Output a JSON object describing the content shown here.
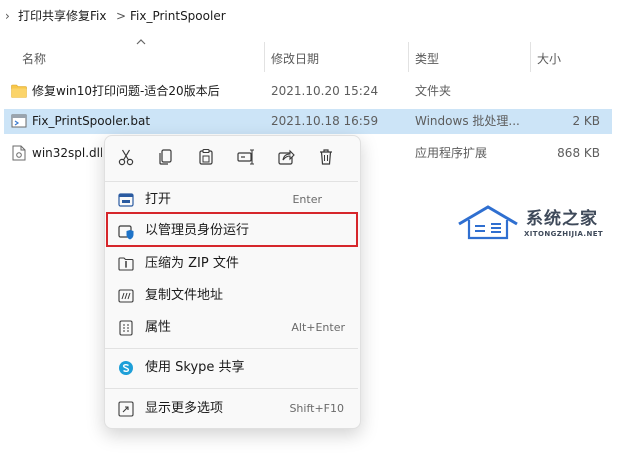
{
  "breadcrumb": {
    "items": [
      "打印共享修复Fix",
      "Fix_PrintSpooler"
    ],
    "separator": ">"
  },
  "columns": {
    "name": "名称",
    "modified": "修改日期",
    "type": "类型",
    "size": "大小"
  },
  "files": [
    {
      "name": "修复win10打印问题-适合20版本后",
      "modified": "2021.10.20 15:24",
      "type": "文件夹",
      "size": "",
      "icon": "folder-icon"
    },
    {
      "name": "Fix_PrintSpooler.bat",
      "modified": "2021.10.18 16:59",
      "type": "Windows 批处理...",
      "size": "2 KB",
      "icon": "batch-file-icon",
      "selected": true
    },
    {
      "name": "win32spl.dll",
      "modified": "",
      "type": "应用程序扩展",
      "size": "868 KB",
      "icon": "dll-file-icon"
    }
  ],
  "context_menu": {
    "quick_actions": [
      "cut-icon",
      "copy-icon",
      "paste-icon",
      "rename-icon",
      "share-icon",
      "delete-icon"
    ],
    "items": [
      {
        "label": "打开",
        "shortcut": "Enter",
        "icon": "open-icon"
      },
      {
        "label": "以管理员身份运行",
        "shortcut": "",
        "icon": "run-as-admin-icon",
        "highlighted": true
      },
      {
        "label": "压缩为 ZIP 文件",
        "shortcut": "",
        "icon": "zip-icon"
      },
      {
        "label": "复制文件地址",
        "shortcut": "",
        "icon": "copy-path-icon"
      },
      {
        "label": "属性",
        "shortcut": "Alt+Enter",
        "icon": "properties-icon"
      },
      {
        "label": "使用 Skype 共享",
        "shortcut": "",
        "icon": "skype-icon"
      },
      {
        "label": "显示更多选项",
        "shortcut": "Shift+F10",
        "icon": "more-options-icon"
      }
    ]
  },
  "watermark": {
    "title": "系统之家",
    "subtitle": "XITONGZHIJIA.NET"
  },
  "colors": {
    "selection": "#cce4f7",
    "highlight_border": "#d6262b",
    "accent": "#1e73c8",
    "folder": "#f8c74a"
  }
}
